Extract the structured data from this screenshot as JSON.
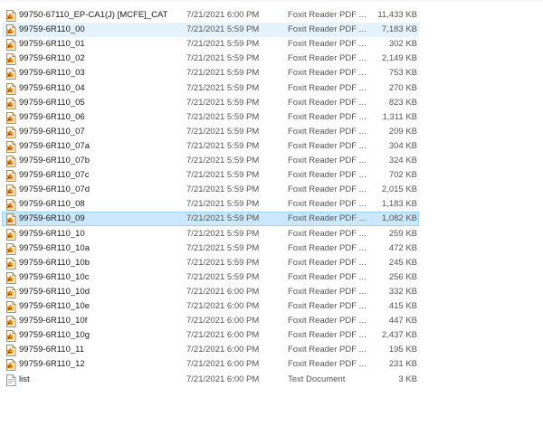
{
  "files": [
    {
      "name": "99750-67110_EP-CA1(J) [MCFE]_CAT",
      "date": "7/21/2021 6:00 PM",
      "type": "Foxit Reader PDF ...",
      "size": "11,433 KB",
      "icon": "pdf-icon",
      "state": "normal"
    },
    {
      "name": "99759-6R110_00",
      "date": "7/21/2021 5:59 PM",
      "type": "Foxit Reader PDF ...",
      "size": "7,183 KB",
      "icon": "pdf-icon",
      "state": "hover"
    },
    {
      "name": "99759-6R110_01",
      "date": "7/21/2021 5:59 PM",
      "type": "Foxit Reader PDF ...",
      "size": "302 KB",
      "icon": "pdf-icon",
      "state": "normal"
    },
    {
      "name": "99759-6R110_02",
      "date": "7/21/2021 5:59 PM",
      "type": "Foxit Reader PDF ...",
      "size": "2,149 KB",
      "icon": "pdf-icon",
      "state": "normal"
    },
    {
      "name": "99759-6R110_03",
      "date": "7/21/2021 5:59 PM",
      "type": "Foxit Reader PDF ...",
      "size": "753 KB",
      "icon": "pdf-icon",
      "state": "normal"
    },
    {
      "name": "99759-6R110_04",
      "date": "7/21/2021 5:59 PM",
      "type": "Foxit Reader PDF ...",
      "size": "270 KB",
      "icon": "pdf-icon",
      "state": "normal"
    },
    {
      "name": "99759-6R110_05",
      "date": "7/21/2021 5:59 PM",
      "type": "Foxit Reader PDF ...",
      "size": "823 KB",
      "icon": "pdf-icon",
      "state": "normal"
    },
    {
      "name": "99759-6R110_06",
      "date": "7/21/2021 5:59 PM",
      "type": "Foxit Reader PDF ...",
      "size": "1,311 KB",
      "icon": "pdf-icon",
      "state": "normal"
    },
    {
      "name": "99759-6R110_07",
      "date": "7/21/2021 5:59 PM",
      "type": "Foxit Reader PDF ...",
      "size": "209 KB",
      "icon": "pdf-icon",
      "state": "normal"
    },
    {
      "name": "99759-6R110_07a",
      "date": "7/21/2021 5:59 PM",
      "type": "Foxit Reader PDF ...",
      "size": "304 KB",
      "icon": "pdf-icon",
      "state": "normal"
    },
    {
      "name": "99759-6R110_07b",
      "date": "7/21/2021 5:59 PM",
      "type": "Foxit Reader PDF ...",
      "size": "324 KB",
      "icon": "pdf-icon",
      "state": "normal"
    },
    {
      "name": "99759-6R110_07c",
      "date": "7/21/2021 5:59 PM",
      "type": "Foxit Reader PDF ...",
      "size": "702 KB",
      "icon": "pdf-icon",
      "state": "normal"
    },
    {
      "name": "99759-6R110_07d",
      "date": "7/21/2021 5:59 PM",
      "type": "Foxit Reader PDF ...",
      "size": "2,015 KB",
      "icon": "pdf-icon",
      "state": "normal"
    },
    {
      "name": "99759-6R110_08",
      "date": "7/21/2021 5:59 PM",
      "type": "Foxit Reader PDF ...",
      "size": "1,183 KB",
      "icon": "pdf-icon",
      "state": "normal"
    },
    {
      "name": "99759-6R110_09",
      "date": "7/21/2021 5:59 PM",
      "type": "Foxit Reader PDF ...",
      "size": "1,082 KB",
      "icon": "pdf-icon",
      "state": "selected"
    },
    {
      "name": "99759-6R110_10",
      "date": "7/21/2021 5:59 PM",
      "type": "Foxit Reader PDF ...",
      "size": "259 KB",
      "icon": "pdf-icon",
      "state": "normal"
    },
    {
      "name": "99759-6R110_10a",
      "date": "7/21/2021 5:59 PM",
      "type": "Foxit Reader PDF ...",
      "size": "472 KB",
      "icon": "pdf-icon",
      "state": "normal"
    },
    {
      "name": "99759-6R110_10b",
      "date": "7/21/2021 5:59 PM",
      "type": "Foxit Reader PDF ...",
      "size": "245 KB",
      "icon": "pdf-icon",
      "state": "normal"
    },
    {
      "name": "99759-6R110_10c",
      "date": "7/21/2021 5:59 PM",
      "type": "Foxit Reader PDF ...",
      "size": "256 KB",
      "icon": "pdf-icon",
      "state": "normal"
    },
    {
      "name": "99759-6R110_10d",
      "date": "7/21/2021 6:00 PM",
      "type": "Foxit Reader PDF ...",
      "size": "332 KB",
      "icon": "pdf-icon",
      "state": "normal"
    },
    {
      "name": "99759-6R110_10e",
      "date": "7/21/2021 6:00 PM",
      "type": "Foxit Reader PDF ...",
      "size": "415 KB",
      "icon": "pdf-icon",
      "state": "normal"
    },
    {
      "name": "99759-6R110_10f",
      "date": "7/21/2021 6:00 PM",
      "type": "Foxit Reader PDF ...",
      "size": "447 KB",
      "icon": "pdf-icon",
      "state": "normal"
    },
    {
      "name": "99759-6R110_10g",
      "date": "7/21/2021 6:00 PM",
      "type": "Foxit Reader PDF ...",
      "size": "2,437 KB",
      "icon": "pdf-icon",
      "state": "normal"
    },
    {
      "name": "99759-6R110_11",
      "date": "7/21/2021 6:00 PM",
      "type": "Foxit Reader PDF ...",
      "size": "195 KB",
      "icon": "pdf-icon",
      "state": "normal"
    },
    {
      "name": "99759-6R110_12",
      "date": "7/21/2021 6:00 PM",
      "type": "Foxit Reader PDF ...",
      "size": "231 KB",
      "icon": "pdf-icon",
      "state": "normal"
    },
    {
      "name": "list",
      "date": "7/21/2021 6:00 PM",
      "type": "Text Document",
      "size": "3 KB",
      "icon": "text-document-icon",
      "state": "normal"
    }
  ]
}
